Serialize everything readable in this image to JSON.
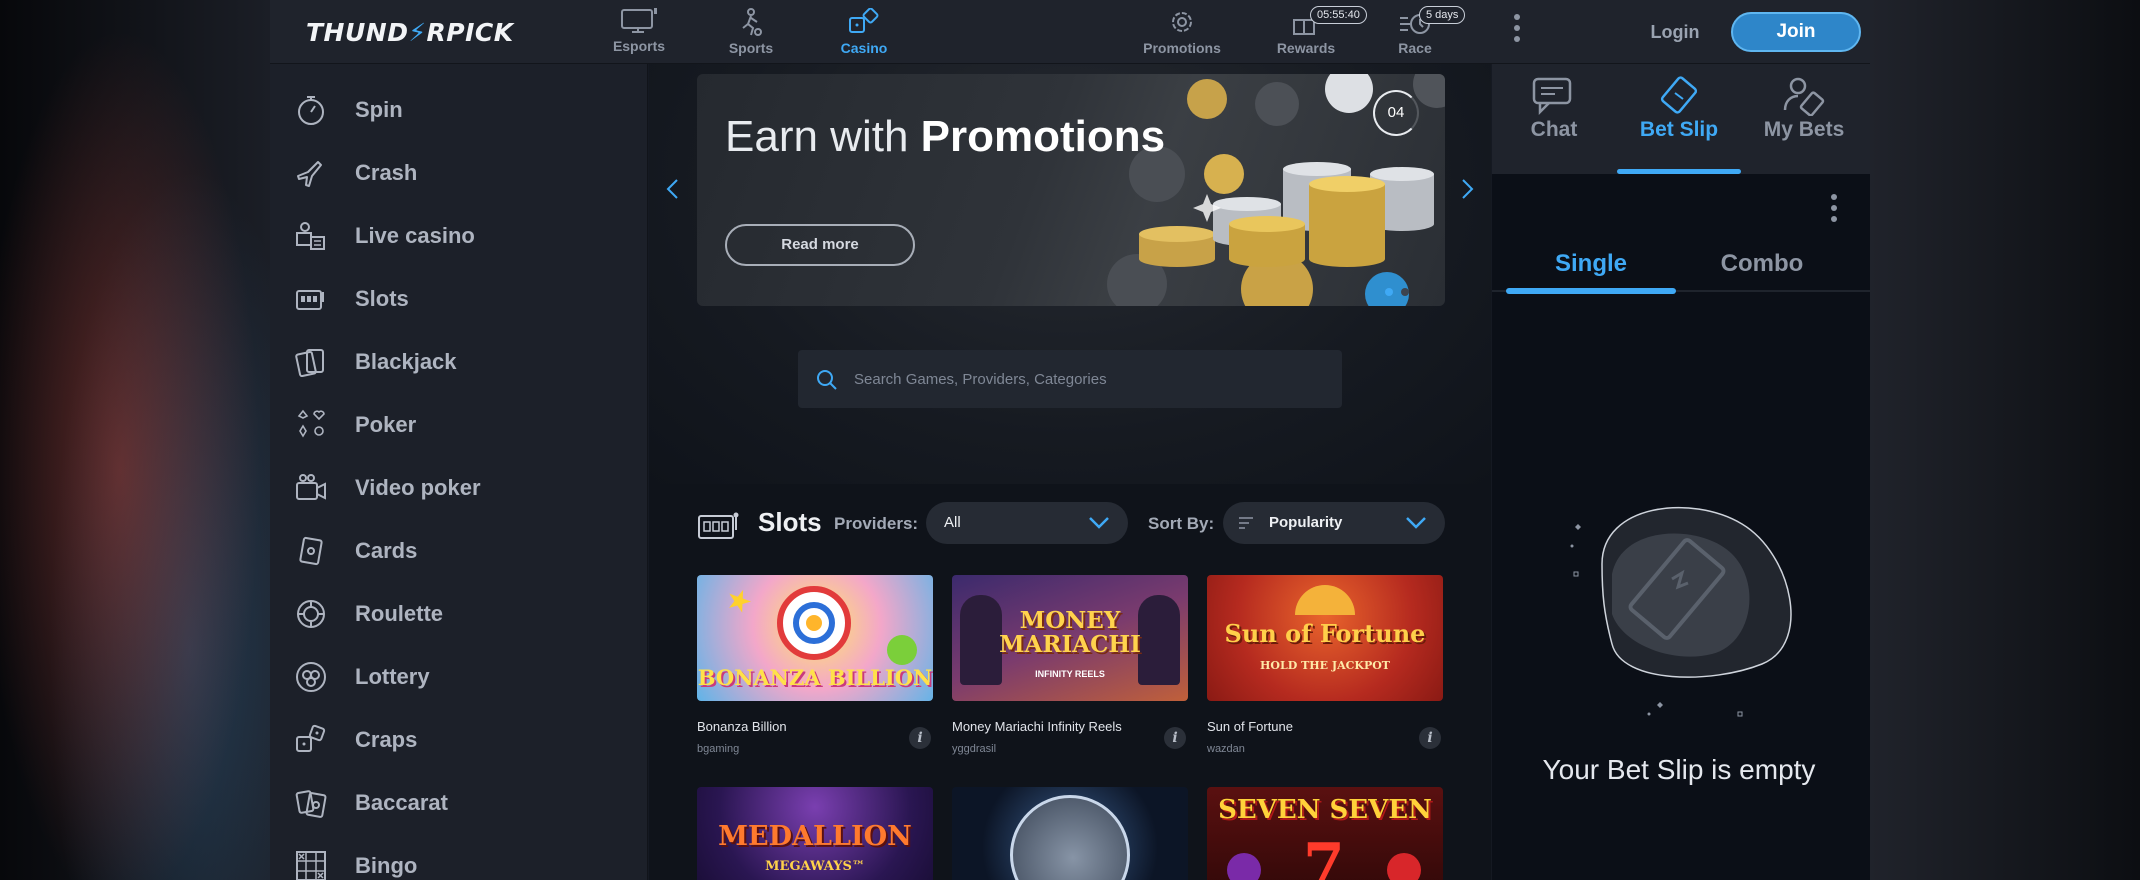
{
  "header": {
    "logo": "THUNDERPICK",
    "nav": [
      {
        "label": "Esports",
        "icon": "monitor-icon"
      },
      {
        "label": "Sports",
        "icon": "soccer-player-icon"
      },
      {
        "label": "Casino",
        "icon": "dice-icon"
      },
      {
        "label": "Promotions",
        "icon": "gear-badge-icon"
      },
      {
        "label": "Rewards",
        "icon": "gift-icon",
        "badge": "05:55:40"
      },
      {
        "label": "Race",
        "icon": "race-clock-icon",
        "badge": "5 days"
      }
    ],
    "login": "Login",
    "join": "Join"
  },
  "sidebar": {
    "items": [
      {
        "label": "Spin",
        "icon": "stopwatch-icon"
      },
      {
        "label": "Crash",
        "icon": "plane-icon"
      },
      {
        "label": "Live casino",
        "icon": "dealer-icon"
      },
      {
        "label": "Slots",
        "icon": "slot-machine-icon"
      },
      {
        "label": "Blackjack",
        "icon": "cards-stack-icon"
      },
      {
        "label": "Poker",
        "icon": "card-suits-icon"
      },
      {
        "label": "Video poker",
        "icon": "video-camera-icon"
      },
      {
        "label": "Cards",
        "icon": "playing-cards-icon"
      },
      {
        "label": "Roulette",
        "icon": "roulette-icon"
      },
      {
        "label": "Lottery",
        "icon": "lottery-ball-icon"
      },
      {
        "label": "Craps",
        "icon": "dice-pair-icon"
      },
      {
        "label": "Baccarat",
        "icon": "baccarat-cards-icon"
      },
      {
        "label": "Bingo",
        "icon": "bingo-grid-icon"
      }
    ]
  },
  "banner": {
    "title_light": "Earn with ",
    "title_bold": "Promotions",
    "button": "Read more",
    "slide": "04"
  },
  "search": {
    "placeholder": "Search Games, Providers, Categories"
  },
  "slots": {
    "title": "Slots",
    "providers_label": "Providers:",
    "providers_value": "All",
    "sort_label": "Sort By:",
    "sort_value": "Popularity"
  },
  "games": [
    {
      "name": "Bonanza Billion",
      "provider": "bgaming",
      "art": "BONANZA BILLION"
    },
    {
      "name": "Money Mariachi Infinity Reels",
      "provider": "yggdrasil",
      "art": "MONEY MARIACHI",
      "art_sub": "INFINITY REELS"
    },
    {
      "name": "Sun of Fortune",
      "provider": "wazdan",
      "art": "Sun of Fortune",
      "art_sub": "HOLD THE JACKPOT"
    },
    {
      "name": "",
      "provider": "",
      "art": "MEDALLION",
      "art_sub": "MEGAWAYS™"
    },
    {
      "name": "",
      "provider": "",
      "art": ""
    },
    {
      "name": "",
      "provider": "",
      "art": "SEVEN SEVEN"
    }
  ],
  "betslip": {
    "tabs": [
      "Chat",
      "Bet Slip",
      "My Bets"
    ],
    "types": [
      "Single",
      "Combo"
    ],
    "empty": "Your Bet Slip is empty"
  },
  "colors": {
    "accent": "#3fa9f5",
    "join_bg": "#2e86c9",
    "panel": "#1c2029"
  }
}
